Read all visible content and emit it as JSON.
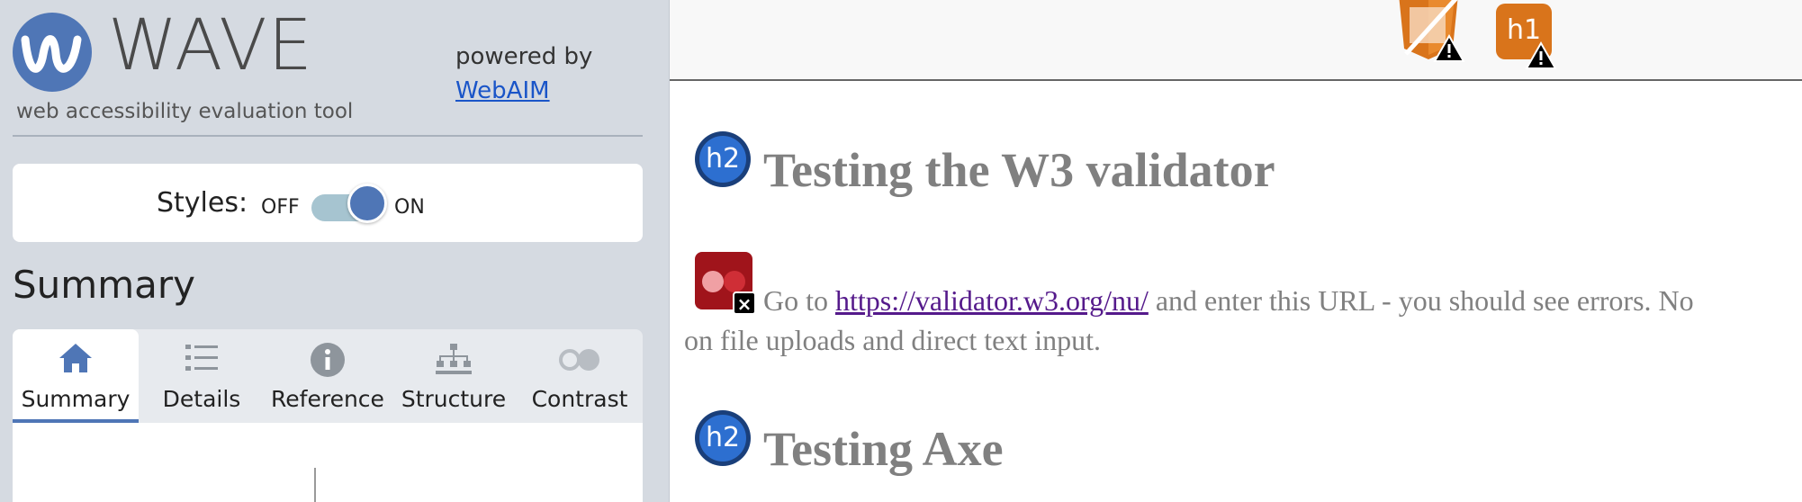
{
  "sidebar": {
    "logo_word": "WAVE",
    "tagline": "web accessibility evaluation tool",
    "powered_by": "powered by",
    "webaim_link": "WebAIM",
    "styles_label": "Styles:",
    "toggle_off": "OFF",
    "toggle_on": "ON",
    "toggle_state": "on",
    "section_heading": "Summary",
    "tabs": [
      {
        "label": "Summary",
        "icon": "home-icon",
        "active": true
      },
      {
        "label": "Details",
        "icon": "list-icon",
        "active": false
      },
      {
        "label": "Reference",
        "icon": "info-icon",
        "active": false
      },
      {
        "label": "Structure",
        "icon": "sitemap-icon",
        "active": false
      },
      {
        "label": "Contrast",
        "icon": "contrast-icon",
        "active": false
      }
    ]
  },
  "page": {
    "top_icons": [
      {
        "name": "html5-alert-icon",
        "type": "alert"
      },
      {
        "name": "h1-alert-icon",
        "label": "h1",
        "type": "alert"
      }
    ],
    "sections": [
      {
        "icon_label": "h2",
        "heading": "Testing the W3 validator",
        "paragraph_before": "Go to ",
        "paragraph_link": "https://validator.w3.org/nu/",
        "paragraph_after": " and enter this URL - you should see errors. No",
        "paragraph_line2": "on file uploads and direct text input."
      },
      {
        "icon_label": "h2",
        "heading": "Testing Axe"
      }
    ]
  },
  "colors": {
    "wave_blue": "#4f76b6",
    "sidebar_bg": "#d5dae1",
    "alert_orange": "#d9741b",
    "error_red": "#a0141b",
    "heading_gray": "#808080",
    "link_purple": "#551a8b"
  }
}
